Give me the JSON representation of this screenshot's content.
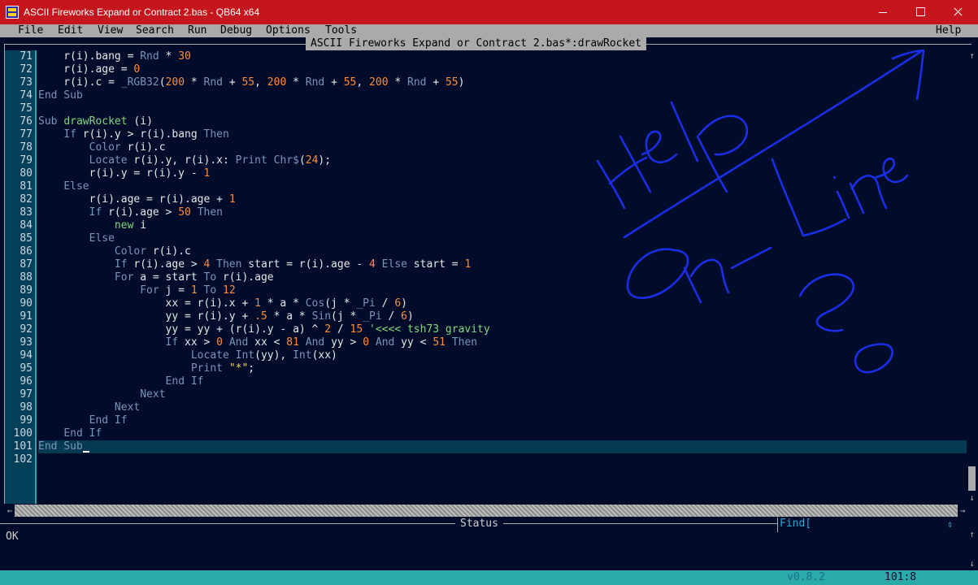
{
  "window": {
    "title": "ASCII Fireworks Expand or Contract 2.bas - QB64 x64"
  },
  "menu": {
    "file": "File",
    "edit": "Edit",
    "view": "View",
    "search": "Search",
    "run": "Run",
    "debug": "Debug",
    "options": "Options",
    "tools": "Tools",
    "help": "Help"
  },
  "editor": {
    "doc_title": "ASCII Fireworks Expand or Contract 2.bas*:drawRocket",
    "line_numbers": [
      "71",
      "72",
      "73",
      "74",
      "75",
      "76",
      "77",
      "78",
      "79",
      "80",
      "81",
      "82",
      "83",
      "84",
      "85",
      "86",
      "87",
      "88",
      "89",
      "90",
      "91",
      "92",
      "93",
      "94",
      "95",
      "96",
      "97",
      "98",
      "99",
      "100",
      "101",
      "102"
    ]
  },
  "code": {
    "l71": [
      "    r(i).bang = ",
      "Rnd",
      " * ",
      "30"
    ],
    "l72": [
      "    r(i).age = ",
      "0"
    ],
    "l73": [
      "    r(i).c = ",
      "_RGB32",
      "(",
      "200",
      " * ",
      "Rnd",
      " + ",
      "55",
      ", ",
      "200",
      " * ",
      "Rnd",
      " + ",
      "55",
      ", ",
      "200",
      " * ",
      "Rnd",
      " + ",
      "55",
      ")"
    ],
    "l74": [
      "End Sub"
    ],
    "l76": [
      "Sub ",
      "drawRocket",
      " (i)"
    ],
    "l77": [
      "    ",
      "If",
      " r(i).y > r(i).bang ",
      "Then"
    ],
    "l78": [
      "        ",
      "Color",
      " r(i).c"
    ],
    "l79": [
      "        ",
      "Locate",
      " r(i).y, r(i).x: ",
      "Print",
      " ",
      "Chr$",
      "(",
      "24",
      ");"
    ],
    "l80": [
      "        r(i).y = r(i).y - ",
      "1"
    ],
    "l81": [
      "    ",
      "Else"
    ],
    "l82": [
      "        r(i).age = r(i).age + ",
      "1"
    ],
    "l83": [
      "        ",
      "If",
      " r(i).age > ",
      "50",
      " ",
      "Then"
    ],
    "l84": [
      "            ",
      "new",
      " i"
    ],
    "l85": [
      "        ",
      "Else"
    ],
    "l86": [
      "            ",
      "Color",
      " r(i).c"
    ],
    "l87": [
      "            ",
      "If",
      " r(i).age > ",
      "4",
      " ",
      "Then",
      " start = r(i).age - ",
      "4",
      " ",
      "Else",
      " start = ",
      "1"
    ],
    "l88": [
      "            ",
      "For",
      " a = start ",
      "To",
      " r(i).age"
    ],
    "l89": [
      "                ",
      "For",
      " j = ",
      "1",
      " ",
      "To",
      " ",
      "12"
    ],
    "l90": [
      "                    xx = r(i).x + ",
      "1",
      " * a * ",
      "Cos",
      "(j * ",
      "_Pi",
      " / ",
      "6",
      ")"
    ],
    "l91": [
      "                    yy = r(i).y + ",
      ".5",
      " * a * ",
      "Sin",
      "(j * ",
      "_Pi",
      " / ",
      "6",
      ")"
    ],
    "l92": [
      "                    yy = yy + (r(i).y - a) ^ ",
      "2",
      " / ",
      "15",
      " ",
      "'<<<< tsh73 gravity"
    ],
    "l93": [
      "                    ",
      "If",
      " xx > ",
      "0",
      " ",
      "And",
      " xx < ",
      "81",
      " ",
      "And",
      " yy > ",
      "0",
      " ",
      "And",
      " yy < ",
      "51",
      " ",
      "Then"
    ],
    "l94": [
      "                        ",
      "Locate",
      " ",
      "Int",
      "(yy), ",
      "Int",
      "(xx)"
    ],
    "l95": [
      "                        ",
      "Print",
      " ",
      "\"*\"",
      ";"
    ],
    "l96": [
      "                    ",
      "End If"
    ],
    "l97": [
      "                ",
      "Next"
    ],
    "l98": [
      "            ",
      "Next"
    ],
    "l99": [
      "        ",
      "End If"
    ],
    "l100": [
      "    ",
      "End If"
    ],
    "l101": [
      "End Sub"
    ]
  },
  "status": {
    "label": "Status",
    "text": "OK",
    "find_label": "Find[",
    "find_arrows": "⇕"
  },
  "bottombar": {
    "version": "v0.8.2",
    "position": "101:8"
  },
  "scrollbar": {
    "up": "↑",
    "down": "↓",
    "left": "←",
    "right": "→"
  },
  "colors": {
    "keyword": "#7a95b8",
    "number": "#ff8c3a",
    "comment": "#7fd97f",
    "string": "#ffd54a",
    "background": "#000c2a",
    "titlebar": "#c4161c"
  }
}
